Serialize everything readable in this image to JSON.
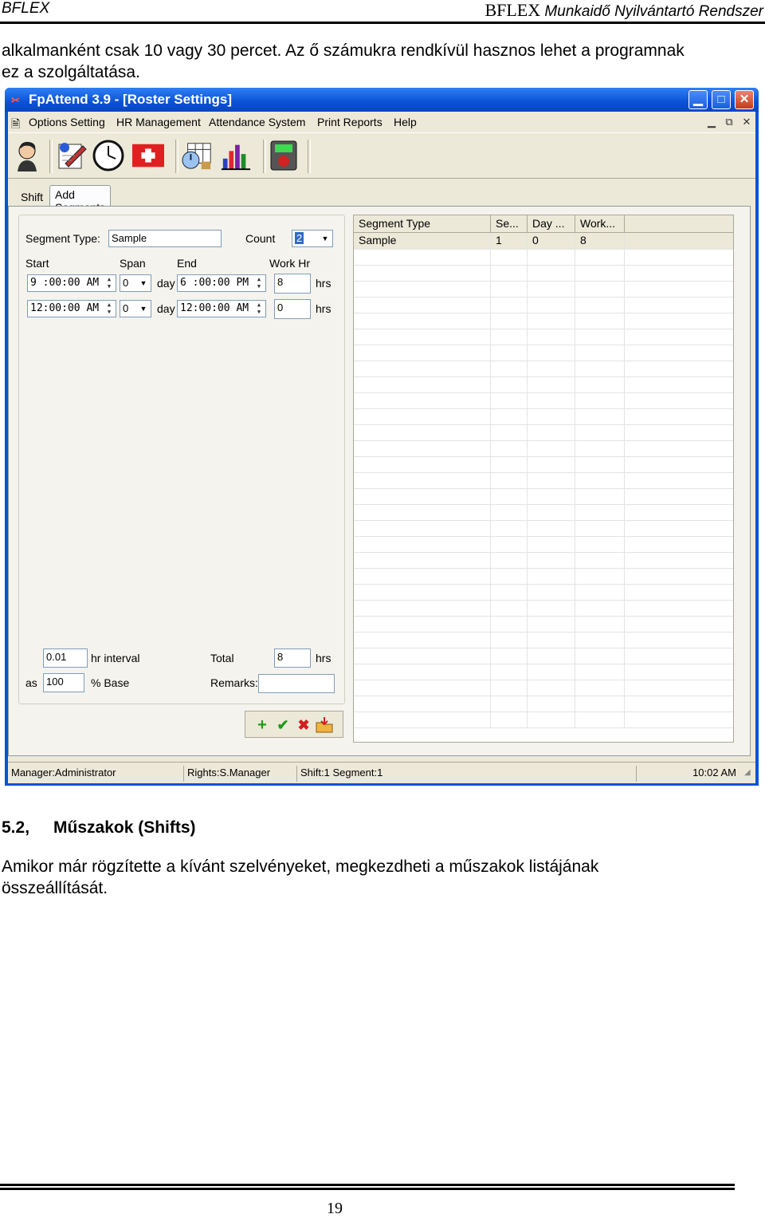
{
  "doc": {
    "header_left": "BFLEX",
    "header_brand": "BFLEX",
    "header_title": "Munkaidő Nyilvántartó Rendszer",
    "intro_line1": "alkalmanként csak 10 vagy 30 percet. Az ő számukra rendkívül hasznos lehet a programnak",
    "intro_line2": "ez a szolgáltatása.",
    "section_number": "5.2,",
    "section_title": "Műszakok (Shifts)",
    "body_line1": "Amikor már rögzítette a kívánt szelvényeket, megkezdheti a műszakok listájának",
    "body_line2": "összeállítását.",
    "page_number": "19"
  },
  "window": {
    "title": "FpAttend 3.9 - [Roster Settings]",
    "menu": [
      "Options Setting",
      "HR Management",
      "Attendance System",
      "Print Reports",
      "Help"
    ],
    "tabs": [
      "Shift",
      "Add Segments"
    ],
    "toolbar_icons": [
      "employee-icon",
      "notes-icon",
      "clock-icon",
      "first-aid-icon",
      "schedule-icon",
      "bar-chart-icon",
      "terminal-icon"
    ]
  },
  "form": {
    "segment_type_label": "Segment Type:",
    "segment_type_value": "Sample",
    "count_label": "Count",
    "count_value": "2",
    "col_start": "Start",
    "col_span": "Span",
    "col_end": "End",
    "col_workhr": "Work Hr",
    "day_label": "day",
    "hrs_label": "hrs",
    "row1": {
      "start": "9 :00:00  AM",
      "span": "0",
      "end": "6 :00:00  PM",
      "work": "8"
    },
    "row2": {
      "start": "12:00:00  AM",
      "span": "0",
      "end": "12:00:00  AM",
      "work": "0"
    },
    "interval_value": "0.01",
    "interval_label": "hr interval",
    "total_label": "Total",
    "total_value": "8",
    "total_unit": "hrs",
    "as_label": "as",
    "base_value": "100",
    "base_label": "% Base",
    "remarks_label": "Remarks:",
    "remarks_value": ""
  },
  "grid": {
    "headers": [
      "Segment Type",
      "Se...",
      "Day ...",
      "Work..."
    ],
    "rows": [
      [
        "Sample",
        "1",
        "0",
        "8"
      ]
    ]
  },
  "status": {
    "manager": "Manager:Administrator",
    "rights": "Rights:S.Manager",
    "shift": "Shift:1  Segment:1",
    "time": "10:02 AM"
  },
  "colors": {
    "titlebar": "#0a52d6",
    "window_bg": "#ece9d8",
    "add": "#1e9b1e",
    "confirm": "#1e9b1e",
    "delete": "#d42020"
  }
}
